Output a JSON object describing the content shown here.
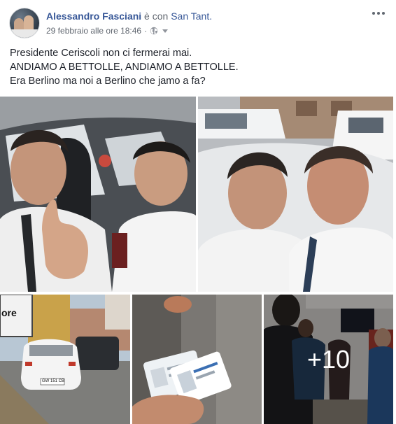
{
  "post": {
    "author_name": "Alessandro Fasciani",
    "with_text": " è con ",
    "tagged_name": "San Tant.",
    "timestamp": "29 febbraio alle ore 18:46",
    "meta_separator": "·",
    "privacy_icon": "globe-icon",
    "options_icon": "more-options-icon",
    "text_lines": [
      "Presidente Ceriscoli non ci fermerai mai.",
      "ANDIAMO A BETTOLLE, ANDIAMO A BETTOLLE.",
      "Era Berlino ma noi a Berlino che jamo a fa?"
    ]
  },
  "photos": {
    "more_count": "+10",
    "sign_text": "ore",
    "plate_text": "GW 151 CB"
  },
  "colors": {
    "link": "#385898",
    "text": "#1d2129",
    "meta": "#616770"
  }
}
